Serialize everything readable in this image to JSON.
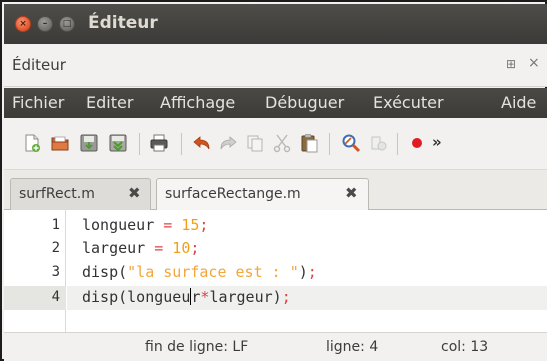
{
  "window": {
    "title": "Éditeur",
    "close_glyph": "×",
    "minimize_glyph": "–",
    "maximize_glyph": "□"
  },
  "panel": {
    "title": "Éditeur",
    "dock_glyph": "⊞",
    "close_glyph": "×"
  },
  "menu": {
    "items": [
      "Fichier",
      "Editer",
      "Affichage",
      "Débuguer",
      "Exécuter",
      "Aide"
    ]
  },
  "toolbar": {
    "icons": [
      "new-file-icon",
      "open-folder-icon",
      "save-icon",
      "save-all-icon",
      "print-icon",
      "undo-icon",
      "redo-icon",
      "copy-icon",
      "cut-icon",
      "paste-icon",
      "find-icon",
      "breakpoint-icon",
      "record-icon"
    ],
    "overflow_label": "»"
  },
  "tabs": [
    {
      "label": "surfRect.m",
      "close_glyph": "✖",
      "active": false
    },
    {
      "label": "surfaceRectange.m",
      "close_glyph": "✖",
      "active": true
    }
  ],
  "editor": {
    "line_numbers": [
      "1",
      "2",
      "3",
      "4"
    ],
    "lines": [
      [
        {
          "t": "longueur ",
          "c": "plain"
        },
        {
          "t": "=",
          "c": "op"
        },
        {
          "t": " 15",
          "c": "num"
        },
        {
          "t": ";",
          "c": "op"
        }
      ],
      [
        {
          "t": "largeur ",
          "c": "plain"
        },
        {
          "t": "=",
          "c": "op"
        },
        {
          "t": " 10",
          "c": "num"
        },
        {
          "t": ";",
          "c": "op"
        }
      ],
      [
        {
          "t": "disp(",
          "c": "plain"
        },
        {
          "t": "\"la surface est : \"",
          "c": "str"
        },
        {
          "t": ")",
          "c": "plain"
        },
        {
          "t": ";",
          "c": "op"
        }
      ],
      [
        {
          "t": "disp(longueu",
          "c": "plain"
        },
        {
          "t": "|caret|",
          "c": "caret"
        },
        {
          "t": "r",
          "c": "plain"
        },
        {
          "t": "*",
          "c": "op"
        },
        {
          "t": "largeur)",
          "c": "plain"
        },
        {
          "t": ";",
          "c": "op"
        }
      ]
    ],
    "current_line": 4
  },
  "status": {
    "eol": "fin de ligne: LF",
    "line": "ligne: 4",
    "col": "col: 13"
  },
  "colors": {
    "title_bar": "#3c3b37",
    "close_button": "#e0542b",
    "operator": "#dd4444",
    "number": "#f29f18",
    "string": "#f4a53c",
    "record_dot": "#e01b24"
  }
}
